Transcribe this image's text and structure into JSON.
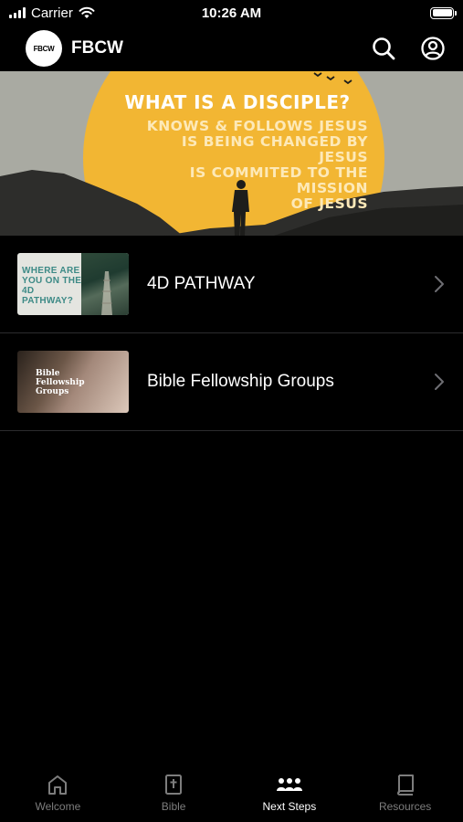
{
  "status_bar": {
    "carrier": "Carrier",
    "time": "10:26 AM"
  },
  "header": {
    "logo_text": "FBCW",
    "title": "FBCW",
    "icons": [
      "search-icon",
      "profile-icon"
    ]
  },
  "hero": {
    "title": "WHAT IS A DISCIPLE?",
    "lines": [
      "KNOWS & FOLLOWS JESUS",
      "IS BEING CHANGED BY",
      "JESUS",
      "IS COMMITED TO THE",
      "MISSION",
      "OF JESUS"
    ],
    "colors": {
      "sun": "#f2b633",
      "sky": "#a9aaa2",
      "mountains": "#2d2d2b"
    }
  },
  "list": {
    "items": [
      {
        "label": "4D PATHWAY",
        "thumbnail_text": "WHERE ARE YOU ON THE 4D PATHWAY?"
      },
      {
        "label": "Bible Fellowship Groups",
        "thumbnail_text": "Bible Fellowship Groups"
      }
    ]
  },
  "tabs": [
    {
      "label": "Welcome",
      "icon": "home-icon",
      "active": false
    },
    {
      "label": "Bible",
      "icon": "bible-icon",
      "active": false
    },
    {
      "label": "Next Steps",
      "icon": "group-icon",
      "active": true
    },
    {
      "label": "Resources",
      "icon": "book-icon",
      "active": false
    }
  ],
  "colors": {
    "background": "#000000",
    "tab_active": "#ffffff",
    "tab_inactive": "#7d7d7d",
    "divider": "#2c2c2e",
    "thumb_accent": "#3d8a86"
  }
}
